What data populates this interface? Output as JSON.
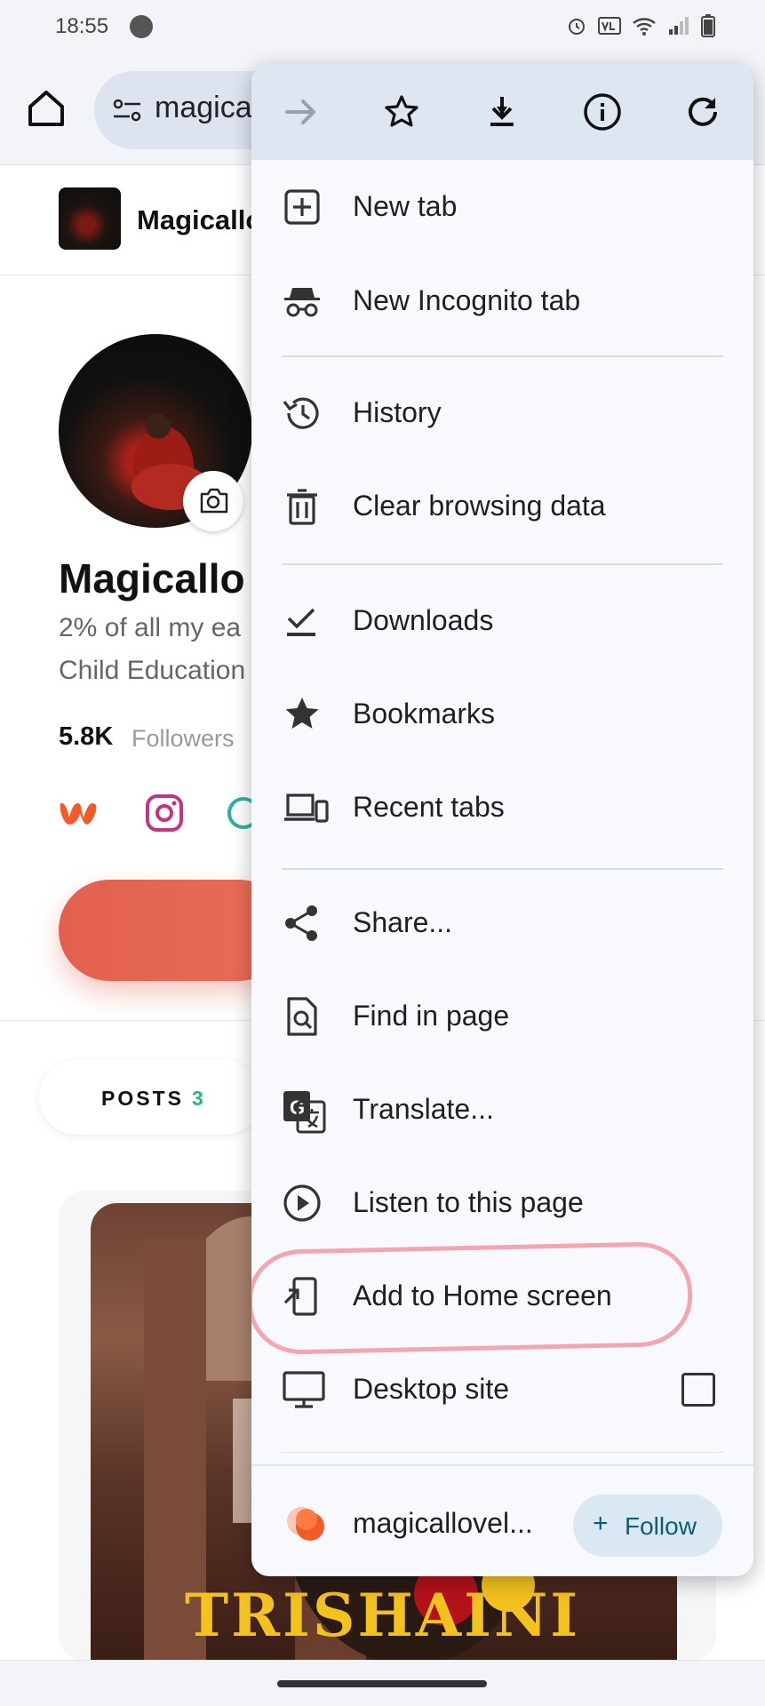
{
  "status_bar": {
    "time": "18:55",
    "icons": [
      "alarm-icon",
      "volte-icon",
      "wifi-icon",
      "signal-icon",
      "battery-icon"
    ]
  },
  "browser": {
    "url_text": "magica"
  },
  "page": {
    "brand": "Magicallo",
    "profile_name": "Magicallo",
    "bio_line1": "2% of all my ea",
    "bio_line2": "Child Education",
    "followers_count": "5.8K",
    "followers_label": "Followers",
    "posts_label": "POSTS",
    "posts_count": "3",
    "cover_title": "TRISHAINI"
  },
  "menu": {
    "items": [
      {
        "label": "New tab",
        "icon": "new-tab-icon"
      },
      {
        "label": "New Incognito tab",
        "icon": "incognito-icon"
      },
      {
        "label": "History",
        "icon": "history-icon"
      },
      {
        "label": "Clear browsing data",
        "icon": "trash-icon"
      },
      {
        "label": "Downloads",
        "icon": "downloads-icon"
      },
      {
        "label": "Bookmarks",
        "icon": "star-filled-icon"
      },
      {
        "label": "Recent tabs",
        "icon": "devices-icon"
      },
      {
        "label": "Share...",
        "icon": "share-icon"
      },
      {
        "label": "Find in page",
        "icon": "find-in-page-icon"
      },
      {
        "label": "Translate...",
        "icon": "translate-icon"
      },
      {
        "label": "Listen to this page",
        "icon": "play-circle-icon"
      },
      {
        "label": "Add to Home screen",
        "icon": "add-to-home-icon"
      },
      {
        "label": "Desktop site",
        "icon": "desktop-icon"
      }
    ],
    "desktop_site_checked": false,
    "footer": {
      "site_name": "magicallovel...",
      "follow_plus": "+",
      "follow_label": "Follow"
    }
  },
  "colors": {
    "accent_follow": "#0b5d7a",
    "highlight": "#f3a5b0",
    "action_button": "#e2604f"
  }
}
